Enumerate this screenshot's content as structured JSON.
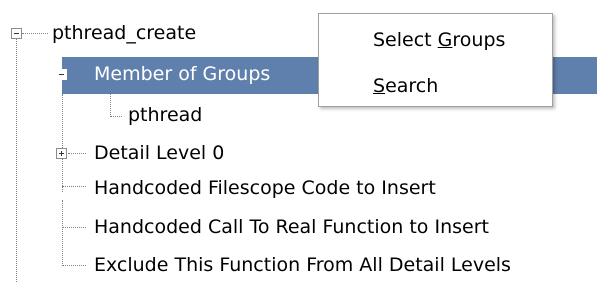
{
  "tree": {
    "nodes": [
      {
        "label": "pthread_create",
        "expander": "minus"
      },
      {
        "label": "Member of Groups",
        "expander": "minus",
        "selected": true
      },
      {
        "label": "pthread",
        "expander": "none"
      },
      {
        "label": "Detail Level 0",
        "expander": "plus"
      },
      {
        "label": "Handcoded Filescope Code to Insert",
        "expander": "none"
      },
      {
        "label": "Handcoded Call To Real Function to Insert",
        "expander": "none"
      },
      {
        "label": "Exclude This Function From All Detail Levels",
        "expander": "none"
      }
    ]
  },
  "context_menu": {
    "items": [
      {
        "pre": "Select ",
        "mnemonic": "G",
        "post": "roups"
      },
      {
        "pre": "",
        "mnemonic": "S",
        "post": "earch"
      }
    ]
  },
  "colors": {
    "selection": "#5f7fad",
    "selection_text": "#ffffff",
    "tree_lines": "#808080",
    "background": "#ffffff"
  }
}
